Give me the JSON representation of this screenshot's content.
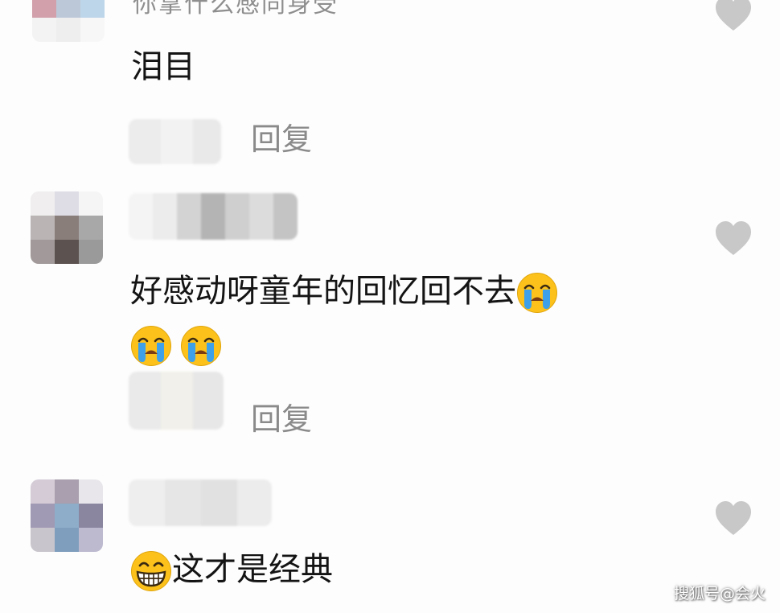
{
  "comments": [
    {
      "text_top": "你拿什么感同身受",
      "text": "泪目",
      "reply_label": "回复"
    },
    {
      "text": "好感动呀童年的回忆回不去",
      "reply_label": "回复",
      "emojis": [
        "loudly-crying-face",
        "loudly-crying-face",
        "loudly-crying-face"
      ]
    },
    {
      "text": "这才是经典",
      "emojis": [
        "grinning-face"
      ]
    }
  ],
  "watermark": "搜狐号@会火",
  "colors": {
    "like_heart": "#c8c8c8",
    "reply": "#8a8a8a",
    "text": "#141414",
    "emoji_yellow": "#fcc21b",
    "tears": "#3ea0e8"
  },
  "icons": [
    "heart-icon",
    "loudly-crying-face-emoji",
    "grinning-face-emoji"
  ]
}
